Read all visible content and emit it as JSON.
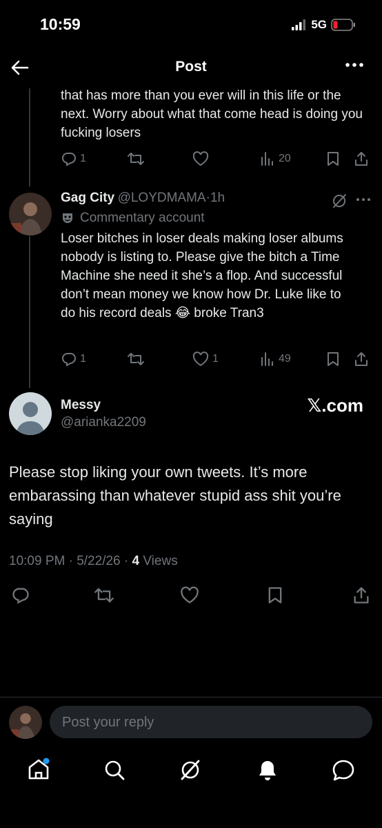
{
  "status": {
    "time": "10:59",
    "network": "5G"
  },
  "nav": {
    "title": "Post"
  },
  "reply1": {
    "text": "that has more than you ever will in this life or the next. Worry about what that come head is doing you fucking losers",
    "replies": "1",
    "views": "20"
  },
  "reply2": {
    "name": "Gag City",
    "handle": "@LOYDMAMA",
    "sep": "·",
    "time": "1h",
    "label": "Commentary account",
    "text": "Loser bitches in loser deals making loser albums nobody is listing to. Please give the bitch a Time Machine she need it she’s a flop. And successful don’t mean money we know how Dr. Luke like to do his record deals 😂 broke Tran3",
    "replies": "1",
    "likes": "1",
    "views": "49"
  },
  "main": {
    "name": "Messy",
    "handle": "@arianka2209",
    "watermark": "𝕏.com",
    "text": "Please stop liking your own tweets. It’s more embarassing than whatever stupid ass shit you’re saying",
    "time": "10:09 PM · 5/22/26 · ",
    "views_count": "4",
    "views_label": " Views"
  },
  "composer": {
    "placeholder": "Post your reply"
  },
  "icons": {
    "reply": "reply-icon",
    "repost": "repost-icon",
    "like": "heart-icon",
    "views": "views-icon",
    "bookmark": "bookmark-icon",
    "share": "share-icon",
    "home": "home-icon",
    "search": "search-icon",
    "grok": "grok-icon",
    "bell": "bell-icon",
    "messages": "messages-icon"
  },
  "colors": {
    "background": "#000000",
    "text": "#e7e9ea",
    "muted": "#71767b",
    "accent": "#1d9bf0",
    "battery_low": "#f4212e"
  }
}
